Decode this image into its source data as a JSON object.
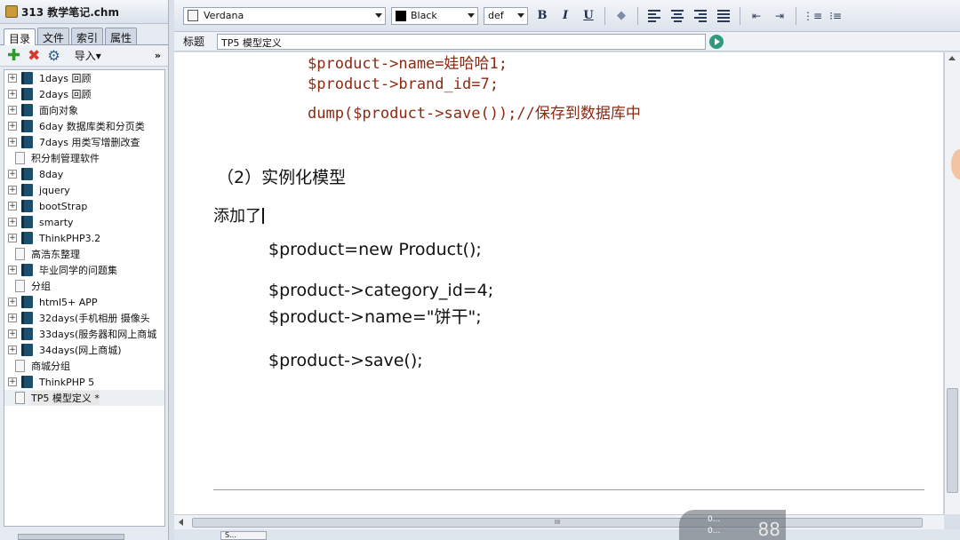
{
  "window": {
    "title": "313 教学笔记.chm"
  },
  "tabs": [
    "目录",
    "文件",
    "索引",
    "属性"
  ],
  "left_toolbar": {
    "import_label": "导入▾",
    "more_label": "»"
  },
  "tree": [
    {
      "label": "1days 回顾",
      "type": "book"
    },
    {
      "label": "2days 回顾",
      "type": "book"
    },
    {
      "label": "面向对象",
      "type": "book"
    },
    {
      "label": "6day 数据库类和分页类",
      "type": "book"
    },
    {
      "label": "7days 用类写增删改查",
      "type": "book"
    },
    {
      "label": "积分制管理软件",
      "type": "page"
    },
    {
      "label": "8day",
      "type": "book"
    },
    {
      "label": "jquery",
      "type": "book"
    },
    {
      "label": "bootStrap",
      "type": "book"
    },
    {
      "label": "smarty",
      "type": "book"
    },
    {
      "label": "ThinkPHP3.2",
      "type": "book"
    },
    {
      "label": "高浩东整理",
      "type": "page"
    },
    {
      "label": "毕业同学的问题集",
      "type": "book"
    },
    {
      "label": "分组",
      "type": "page"
    },
    {
      "label": "html5+ APP",
      "type": "book"
    },
    {
      "label": "32days(手机相册 摄像头",
      "type": "book"
    },
    {
      "label": "33days(服务器和网上商城",
      "type": "book"
    },
    {
      "label": "34days(网上商城)",
      "type": "book"
    },
    {
      "label": "商城分组",
      "type": "page"
    },
    {
      "label": "ThinkPHP 5",
      "type": "book"
    },
    {
      "label": "TP5 模型定义 *",
      "type": "page",
      "selected": true
    }
  ],
  "format_bar": {
    "font": "Verdana",
    "color": "Black",
    "size": "def",
    "bold": "B",
    "italic": "I",
    "underline": "U"
  },
  "title_field": {
    "label": "标题",
    "value": "TP5 模型定义"
  },
  "content": {
    "top_lines": [
      "$product->name=娃哈哈1;",
      "$product->brand_id=7;",
      "dump($product->save());//保存到数据库中"
    ],
    "heading": "（2）实例化模型",
    "added": "添加了",
    "code": [
      "$product=new Product();",
      "$product->category_id=4;",
      "$product->name=\"饼干\";",
      "$product->save();"
    ]
  },
  "hscroll_grip": "III",
  "status": {
    "tab": "S...",
    "overlay_line1": "0...",
    "overlay_line2": "0...",
    "overlay_big": "88"
  }
}
